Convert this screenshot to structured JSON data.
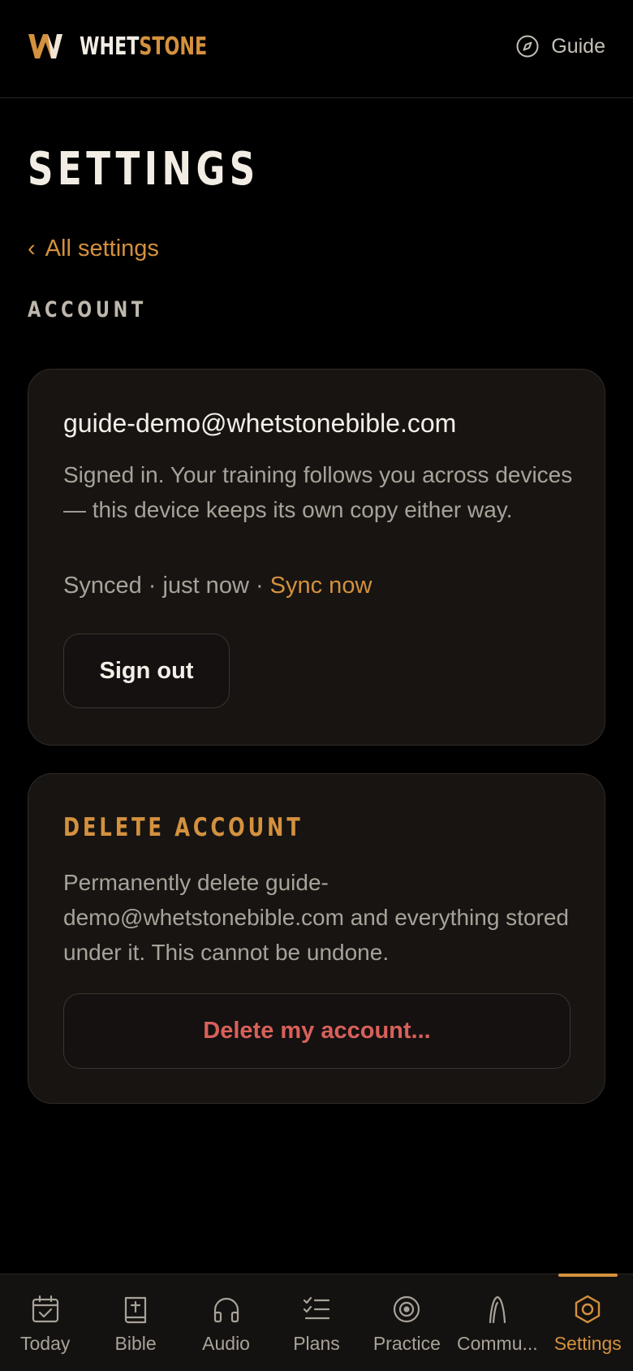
{
  "header": {
    "brand_part1": "WHET",
    "brand_part2": "STONE",
    "guide_label": "Guide"
  },
  "page": {
    "title": "SETTINGS",
    "back_link": "All settings",
    "back_chevron": "‹",
    "section_label": "ACCOUNT"
  },
  "account": {
    "email": "guide-demo@whetstonebible.com",
    "description": "Signed in. Your training follows you across devices — this device keeps its own copy either way.",
    "sync_status": "Synced · just now · ",
    "sync_now": "Sync now",
    "sign_out": "Sign out"
  },
  "delete_account": {
    "heading": "DELETE ACCOUNT",
    "description": "Permanently delete guide-demo@whetstonebible.com and everything stored under it. This cannot be undone.",
    "button": "Delete my account..."
  },
  "nav": {
    "items": [
      {
        "label": "Today",
        "icon": "calendar-check-icon"
      },
      {
        "label": "Bible",
        "icon": "bible-icon"
      },
      {
        "label": "Audio",
        "icon": "headphones-icon"
      },
      {
        "label": "Plans",
        "icon": "checklist-icon"
      },
      {
        "label": "Practice",
        "icon": "target-icon"
      },
      {
        "label": "Commu...",
        "icon": "arch-icon"
      },
      {
        "label": "Settings",
        "icon": "hexagon-settings-icon"
      }
    ],
    "active": "Settings"
  },
  "colors": {
    "accent": "#d4913e",
    "danger": "#d9605a",
    "background": "#000000",
    "card": "#171412"
  }
}
